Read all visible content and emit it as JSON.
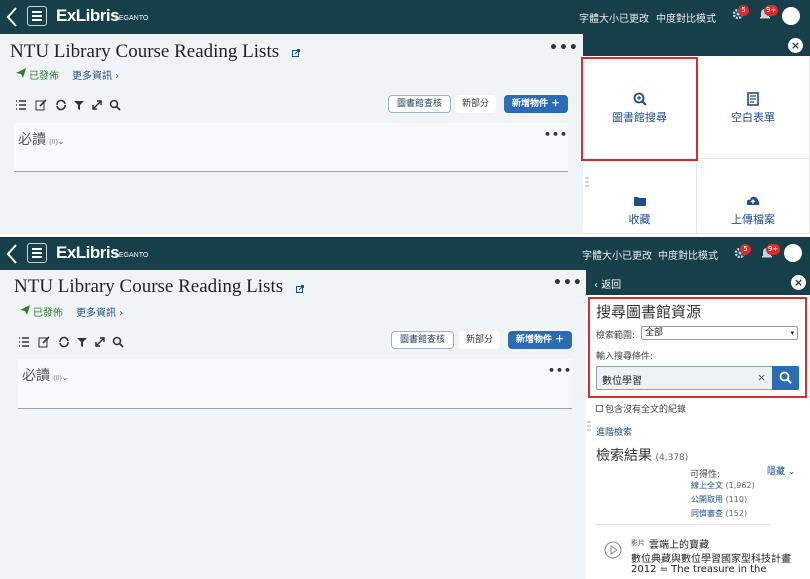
{
  "app": {
    "logo": "ExLibris",
    "logo_sub": "LEGANTO"
  },
  "topbar": {
    "font_size": "字體大小已更改",
    "contrast": "中度對比模式",
    "settings_badge": "5",
    "notifications_badge": "9+"
  },
  "list": {
    "title": "NTU Library Course Reading Lists",
    "status": "已發佈",
    "more_info": "更多資訊",
    "toolbar": {
      "catalog_check": "圖書館查核",
      "new_section": "新部分",
      "add_item": "新增物件"
    },
    "section": {
      "title": "必讀",
      "count": "(0)"
    }
  },
  "add_menu": {
    "library_search": "圖書館搜尋",
    "blank_form": "空白表單",
    "collections": "收藏",
    "upload_file": "上傳檔案"
  },
  "search_panel": {
    "back": "返回",
    "heading": "搜尋圖書館資源",
    "scope_label": "檢索範圍:",
    "scope_value": "全部",
    "query_label": "輸入搜尋條件:",
    "query_value": "數位學習",
    "include_no_fulltext": "包含沒有全文的紀錄",
    "advanced": "進階檢索",
    "results_label": "檢索結果",
    "results_count": "(4,378)",
    "availability_label": "可得性:",
    "hide": "隱藏",
    "facets": [
      {
        "label": "線上全文",
        "count": "(1,962)"
      },
      {
        "label": "公開取用",
        "count": "(110)"
      },
      {
        "label": "同儕審查",
        "count": "(152)"
      }
    ],
    "result": {
      "type": "影片",
      "line1": "雲端上的寶藏",
      "line2": "數位典藏與數位學習國家型科技計畫",
      "line3": "2012 = The treasure in the"
    }
  }
}
